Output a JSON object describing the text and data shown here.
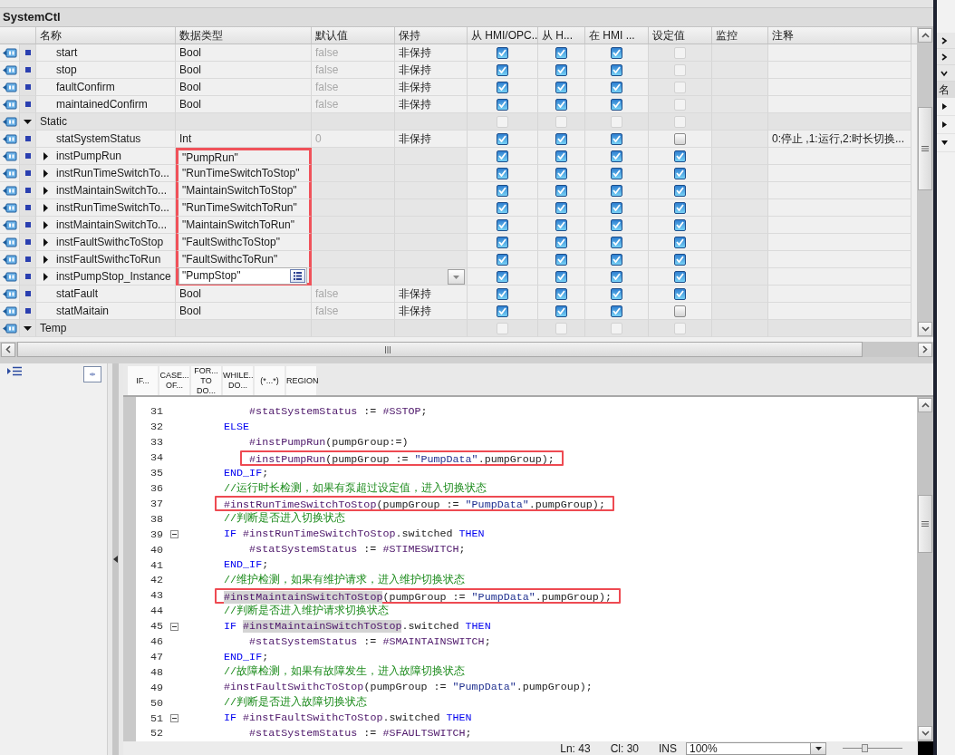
{
  "window": {
    "title": "SystemCtl"
  },
  "table": {
    "columns": [
      "名称",
      "数据类型",
      "默认值",
      "保持",
      "从 HMI/OPC..",
      "从 H...",
      "在 HMI ...",
      "设定值",
      "监控",
      "注释"
    ],
    "rows": [
      {
        "kind": "member",
        "name": "start",
        "type": "Bool",
        "default": "false",
        "retain": "非保持",
        "editing": false,
        "highlighted": false,
        "checks": [
          {
            "checked": true,
            "disabled": false
          },
          {
            "checked": true,
            "disabled": false
          },
          {
            "checked": true,
            "disabled": false
          },
          {
            "checked": false,
            "disabled": true
          }
        ]
      },
      {
        "kind": "member",
        "name": "stop",
        "type": "Bool",
        "default": "false",
        "retain": "非保持",
        "editing": false,
        "highlighted": false,
        "checks": [
          {
            "checked": true,
            "disabled": false
          },
          {
            "checked": true,
            "disabled": false
          },
          {
            "checked": true,
            "disabled": false
          },
          {
            "checked": false,
            "disabled": true
          }
        ]
      },
      {
        "kind": "member",
        "name": "faultConfirm",
        "type": "Bool",
        "default": "false",
        "retain": "非保持",
        "editing": false,
        "highlighted": false,
        "checks": [
          {
            "checked": true,
            "disabled": false
          },
          {
            "checked": true,
            "disabled": false
          },
          {
            "checked": true,
            "disabled": false
          },
          {
            "checked": false,
            "disabled": true
          }
        ]
      },
      {
        "kind": "member",
        "name": "maintainedConfirm",
        "type": "Bool",
        "default": "false",
        "retain": "非保持",
        "editing": false,
        "highlighted": false,
        "checks": [
          {
            "checked": true,
            "disabled": false
          },
          {
            "checked": true,
            "disabled": false
          },
          {
            "checked": true,
            "disabled": false
          },
          {
            "checked": false,
            "disabled": true
          }
        ]
      },
      {
        "kind": "section",
        "name": "Static",
        "expanded": true,
        "editing": false,
        "highlighted": false,
        "checks": [
          {
            "checked": false,
            "disabled": true
          },
          {
            "checked": false,
            "disabled": true
          },
          {
            "checked": false,
            "disabled": true
          },
          {
            "checked": false,
            "disabled": true
          }
        ]
      },
      {
        "kind": "member",
        "name": "statSystemStatus",
        "type": "Int",
        "default": "0",
        "retain": "非保持",
        "comment": "0:停止 ,1:运行,2:时长切换...",
        "editing": false,
        "highlighted": false,
        "checks": [
          {
            "checked": true,
            "disabled": false
          },
          {
            "checked": true,
            "disabled": false
          },
          {
            "checked": true,
            "disabled": false
          },
          {
            "checked": false,
            "disabled": false
          }
        ]
      },
      {
        "kind": "member",
        "name": "instPumpRun",
        "expanded": false,
        "type": "\"PumpRun\"",
        "editing": false,
        "highlighted": true,
        "checks": [
          {
            "checked": true,
            "disabled": false
          },
          {
            "checked": true,
            "disabled": false
          },
          {
            "checked": true,
            "disabled": false
          },
          {
            "checked": true,
            "disabled": false
          }
        ]
      },
      {
        "kind": "member",
        "name": "instRunTimeSwitchTo...",
        "expanded": false,
        "type": "\"RunTimeSwitchToStop\"",
        "editing": false,
        "highlighted": true,
        "checks": [
          {
            "checked": true,
            "disabled": false
          },
          {
            "checked": true,
            "disabled": false
          },
          {
            "checked": true,
            "disabled": false
          },
          {
            "checked": true,
            "disabled": false
          }
        ]
      },
      {
        "kind": "member",
        "name": "instMaintainSwitchTo...",
        "expanded": false,
        "type": "\"MaintainSwitchToStop\"",
        "editing": false,
        "highlighted": true,
        "checks": [
          {
            "checked": true,
            "disabled": false
          },
          {
            "checked": true,
            "disabled": false
          },
          {
            "checked": true,
            "disabled": false
          },
          {
            "checked": true,
            "disabled": false
          }
        ]
      },
      {
        "kind": "member",
        "name": "instRunTimeSwitchTo...",
        "expanded": false,
        "type": "\"RunTimeSwitchToRun\"",
        "editing": false,
        "highlighted": true,
        "checks": [
          {
            "checked": true,
            "disabled": false
          },
          {
            "checked": true,
            "disabled": false
          },
          {
            "checked": true,
            "disabled": false
          },
          {
            "checked": true,
            "disabled": false
          }
        ]
      },
      {
        "kind": "member",
        "name": "instMaintainSwitchTo...",
        "expanded": false,
        "type": "\"MaintainSwitchToRun\"",
        "editing": false,
        "highlighted": true,
        "checks": [
          {
            "checked": true,
            "disabled": false
          },
          {
            "checked": true,
            "disabled": false
          },
          {
            "checked": true,
            "disabled": false
          },
          {
            "checked": true,
            "disabled": false
          }
        ]
      },
      {
        "kind": "member",
        "name": "instFaultSwithcToStop",
        "expanded": false,
        "type": "\"FaultSwithcToStop\"",
        "editing": false,
        "highlighted": true,
        "checks": [
          {
            "checked": true,
            "disabled": false
          },
          {
            "checked": true,
            "disabled": false
          },
          {
            "checked": true,
            "disabled": false
          },
          {
            "checked": true,
            "disabled": false
          }
        ]
      },
      {
        "kind": "member",
        "name": "instFaultSwithcToRun",
        "expanded": false,
        "type": "\"FaultSwithcToRun\"",
        "editing": false,
        "highlighted": true,
        "checks": [
          {
            "checked": true,
            "disabled": false
          },
          {
            "checked": true,
            "disabled": false
          },
          {
            "checked": true,
            "disabled": false
          },
          {
            "checked": true,
            "disabled": false
          }
        ]
      },
      {
        "kind": "member",
        "name": "instPumpStop_Instance",
        "expanded": false,
        "type": "\"PumpStop\"",
        "editing": true,
        "highlighted": true,
        "checks": [
          {
            "checked": true,
            "disabled": false
          },
          {
            "checked": true,
            "disabled": false
          },
          {
            "checked": true,
            "disabled": false
          },
          {
            "checked": true,
            "disabled": false
          }
        ]
      },
      {
        "kind": "member",
        "name": "statFault",
        "type": "Bool",
        "default": "false",
        "retain": "非保持",
        "editing": false,
        "highlighted": false,
        "checks": [
          {
            "checked": true,
            "disabled": false
          },
          {
            "checked": true,
            "disabled": false
          },
          {
            "checked": true,
            "disabled": false
          },
          {
            "checked": true,
            "disabled": false
          }
        ]
      },
      {
        "kind": "member",
        "name": "statMaitain",
        "type": "Bool",
        "default": "false",
        "retain": "非保持",
        "editing": false,
        "highlighted": false,
        "checks": [
          {
            "checked": true,
            "disabled": false
          },
          {
            "checked": true,
            "disabled": false
          },
          {
            "checked": true,
            "disabled": false
          },
          {
            "checked": false,
            "disabled": false
          }
        ]
      },
      {
        "kind": "section",
        "name": "Temp",
        "expanded": true,
        "editing": false,
        "highlighted": false,
        "checks": [
          {
            "checked": false,
            "disabled": true
          },
          {
            "checked": false,
            "disabled": true
          },
          {
            "checked": false,
            "disabled": true
          },
          {
            "checked": false,
            "disabled": true
          }
        ]
      }
    ]
  },
  "editor": {
    "snippets": [
      "IF...",
      "CASE...\nOF...",
      "FOR...\nTO DO...",
      "WHILE..\nDO...",
      "(*...*)",
      "REGION"
    ],
    "lines": [
      {
        "number": "31",
        "fold": false,
        "highlighted": false,
        "tokens": [
          {
            "kind": "var",
            "text": "        #statSystemStatus"
          },
          {
            "kind": "plain",
            "text": " := "
          },
          {
            "kind": "var",
            "text": "#SSTOP"
          },
          {
            "kind": "plain",
            "text": ";"
          }
        ]
      },
      {
        "number": "32",
        "fold": false,
        "highlighted": false,
        "tokens": [
          {
            "kind": "keyword",
            "text": "    ELSE"
          }
        ]
      },
      {
        "number": "33",
        "fold": false,
        "highlighted": false,
        "tokens": [
          {
            "kind": "var",
            "text": "        #instPumpRun"
          },
          {
            "kind": "plain",
            "text": "(pumpGroup:=)"
          }
        ]
      },
      {
        "number": "34",
        "fold": false,
        "highlighted": true,
        "tokens": [
          {
            "kind": "var",
            "text": "        #instPumpRun"
          },
          {
            "kind": "plain",
            "text": "(pumpGroup := "
          },
          {
            "kind": "string",
            "text": "\"PumpData\""
          },
          {
            "kind": "plain",
            "text": ".pumpGroup);"
          }
        ]
      },
      {
        "number": "35",
        "fold": false,
        "highlighted": false,
        "tokens": [
          {
            "kind": "keyword",
            "text": "    END_IF"
          },
          {
            "kind": "plain",
            "text": ";"
          }
        ]
      },
      {
        "number": "36",
        "fold": false,
        "highlighted": false,
        "tokens": [
          {
            "kind": "comment",
            "text": "    //运行时长检测，如果有泵超过设定值，进入切换状态"
          }
        ]
      },
      {
        "number": "37",
        "fold": false,
        "highlighted": true,
        "tokens": [
          {
            "kind": "var",
            "text": "    #instRunTimeSwitchToStop"
          },
          {
            "kind": "plain",
            "text": "(pumpGroup := "
          },
          {
            "kind": "string",
            "text": "\"PumpData\""
          },
          {
            "kind": "plain",
            "text": ".pumpGroup);"
          }
        ]
      },
      {
        "number": "38",
        "fold": false,
        "highlighted": false,
        "tokens": [
          {
            "kind": "comment",
            "text": "    //判断是否进入切换状态"
          }
        ]
      },
      {
        "number": "39",
        "fold": true,
        "highlighted": false,
        "tokens": [
          {
            "kind": "keyword",
            "text": "    IF"
          },
          {
            "kind": "var",
            "text": " #instRunTimeSwitchToStop"
          },
          {
            "kind": "plain",
            "text": ".switched "
          },
          {
            "kind": "keyword",
            "text": "THEN"
          }
        ]
      },
      {
        "number": "40",
        "fold": false,
        "highlighted": false,
        "tokens": [
          {
            "kind": "var",
            "text": "        #statSystemStatus"
          },
          {
            "kind": "plain",
            "text": " := "
          },
          {
            "kind": "var",
            "text": "#STIMESWITCH"
          },
          {
            "kind": "plain",
            "text": ";"
          }
        ]
      },
      {
        "number": "41",
        "fold": false,
        "highlighted": false,
        "tokens": [
          {
            "kind": "keyword",
            "text": "    END_IF"
          },
          {
            "kind": "plain",
            "text": ";"
          }
        ]
      },
      {
        "number": "42",
        "fold": false,
        "highlighted": false,
        "tokens": [
          {
            "kind": "comment",
            "text": "    //维护检测，如果有维护请求，进入维护切换状态"
          }
        ]
      },
      {
        "number": "43",
        "fold": false,
        "highlighted": true,
        "tokens": [
          {
            "kind": "occurrence",
            "text": "    #instMaintainSwitchToStop"
          },
          {
            "kind": "plain",
            "text": "(pumpGroup := "
          },
          {
            "kind": "string",
            "text": "\"PumpData\""
          },
          {
            "kind": "plain",
            "text": ".pumpGroup);"
          }
        ]
      },
      {
        "number": "44",
        "fold": false,
        "highlighted": false,
        "tokens": [
          {
            "kind": "comment",
            "text": "    //判断是否进入维护请求切换状态"
          }
        ]
      },
      {
        "number": "45",
        "fold": true,
        "highlighted": false,
        "tokens": [
          {
            "kind": "keyword",
            "text": "    IF"
          },
          {
            "kind": "occurrence",
            "text": " #instMaintainSwitchToStop"
          },
          {
            "kind": "plain",
            "text": ".switched "
          },
          {
            "kind": "keyword",
            "text": "THEN"
          }
        ]
      },
      {
        "number": "46",
        "fold": false,
        "highlighted": false,
        "tokens": [
          {
            "kind": "var",
            "text": "        #statSystemStatus"
          },
          {
            "kind": "plain",
            "text": " := "
          },
          {
            "kind": "var",
            "text": "#SMAINTAINSWITCH"
          },
          {
            "kind": "plain",
            "text": ";"
          }
        ]
      },
      {
        "number": "47",
        "fold": false,
        "highlighted": false,
        "tokens": [
          {
            "kind": "keyword",
            "text": "    END_IF"
          },
          {
            "kind": "plain",
            "text": ";"
          }
        ]
      },
      {
        "number": "48",
        "fold": false,
        "highlighted": false,
        "tokens": [
          {
            "kind": "comment",
            "text": "    //故障检测，如果有故障发生，进入故障切换状态"
          }
        ]
      },
      {
        "number": "49",
        "fold": false,
        "highlighted": false,
        "tokens": [
          {
            "kind": "var",
            "text": "    #instFaultSwithcToStop"
          },
          {
            "kind": "plain",
            "text": "(pumpGroup := "
          },
          {
            "kind": "string",
            "text": "\"PumpData\""
          },
          {
            "kind": "plain",
            "text": ".pumpGroup);"
          }
        ]
      },
      {
        "number": "50",
        "fold": false,
        "highlighted": false,
        "tokens": [
          {
            "kind": "comment",
            "text": "    //判断是否进入故障切换状态"
          }
        ]
      },
      {
        "number": "51",
        "fold": true,
        "highlighted": false,
        "tokens": [
          {
            "kind": "keyword",
            "text": "    IF"
          },
          {
            "kind": "var",
            "text": " #instFaultSwithcToStop"
          },
          {
            "kind": "plain",
            "text": ".switched "
          },
          {
            "kind": "keyword",
            "text": "THEN"
          }
        ]
      },
      {
        "number": "52",
        "fold": false,
        "highlighted": false,
        "tokens": [
          {
            "kind": "var",
            "text": "        #statSystemStatus"
          },
          {
            "kind": "plain",
            "text": " := "
          },
          {
            "kind": "var",
            "text": "#SFAULTSWITCH"
          },
          {
            "kind": "plain",
            "text": ";"
          }
        ]
      }
    ]
  },
  "status_bar": {
    "line": "Ln: 43",
    "column": "Cl: 30",
    "mode": "INS",
    "zoom": "100%",
    "zoom_slider": {
      "level": 0.37
    }
  },
  "side_panel": {
    "header": "名"
  }
}
